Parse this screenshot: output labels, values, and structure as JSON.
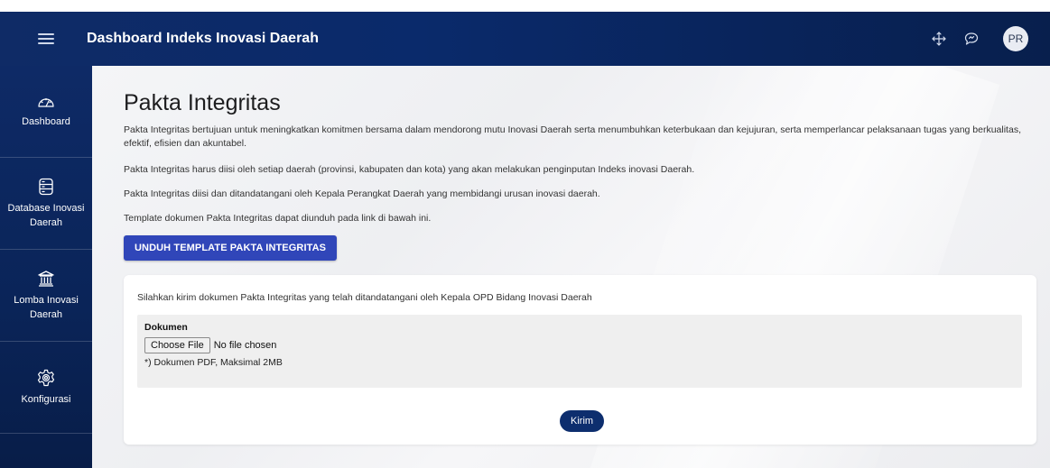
{
  "header": {
    "title": "Dashboard Indeks Inovasi Daerah",
    "icons": [
      "menu-icon",
      "move-icon",
      "chat-icon"
    ],
    "avatar_initials": "PR"
  },
  "sidebar": {
    "items": [
      {
        "label": "Dashboard",
        "icon": "speedometer-icon"
      },
      {
        "label": "Database Inovasi Daerah",
        "icon": "database-icon"
      },
      {
        "label": "Lomba Inovasi Daerah",
        "icon": "institution-icon"
      },
      {
        "label": "Konfigurasi",
        "icon": "gear-icon"
      }
    ]
  },
  "main": {
    "title": "Pakta Integritas",
    "paragraphs": [
      "Pakta Integritas bertujuan untuk meningkatkan komitmen bersama dalam mendorong mutu Inovasi Daerah serta menumbuhkan keterbukaan dan kejujuran, serta memperlancar pelaksanaan tugas yang berkualitas, efektif, efisien dan akuntabel.",
      "Pakta Integritas harus diisi oleh setiap daerah (provinsi, kabupaten dan kota) yang akan melakukan penginputan Indeks inovasi Daerah.",
      "Pakta Integritas diisi dan ditandatangani oleh Kepala Perangkat Daerah yang membidangi urusan inovasi daerah.",
      "Template dokumen Pakta Integritas dapat diunduh pada link di bawah ini."
    ],
    "download_button": "UNDUH TEMPLATE PAKTA INTEGRITAS"
  },
  "upload_card": {
    "intro": "Silahkan kirim dokumen Pakta Integritas yang telah ditandatangani oleh Kepala OPD Bidang Inovasi Daerah",
    "field_label": "Dokumen",
    "choose_file_label": "Choose File",
    "file_status": "No file chosen",
    "hint": "*) Dokumen PDF, Maksimal 2MB",
    "submit_label": "Kirim"
  },
  "colors": {
    "header_bg": "#0a2a6b",
    "sidebar_bg": "#0a2458",
    "accent_button": "#3046b9",
    "submit_button": "#0d2e6e"
  }
}
